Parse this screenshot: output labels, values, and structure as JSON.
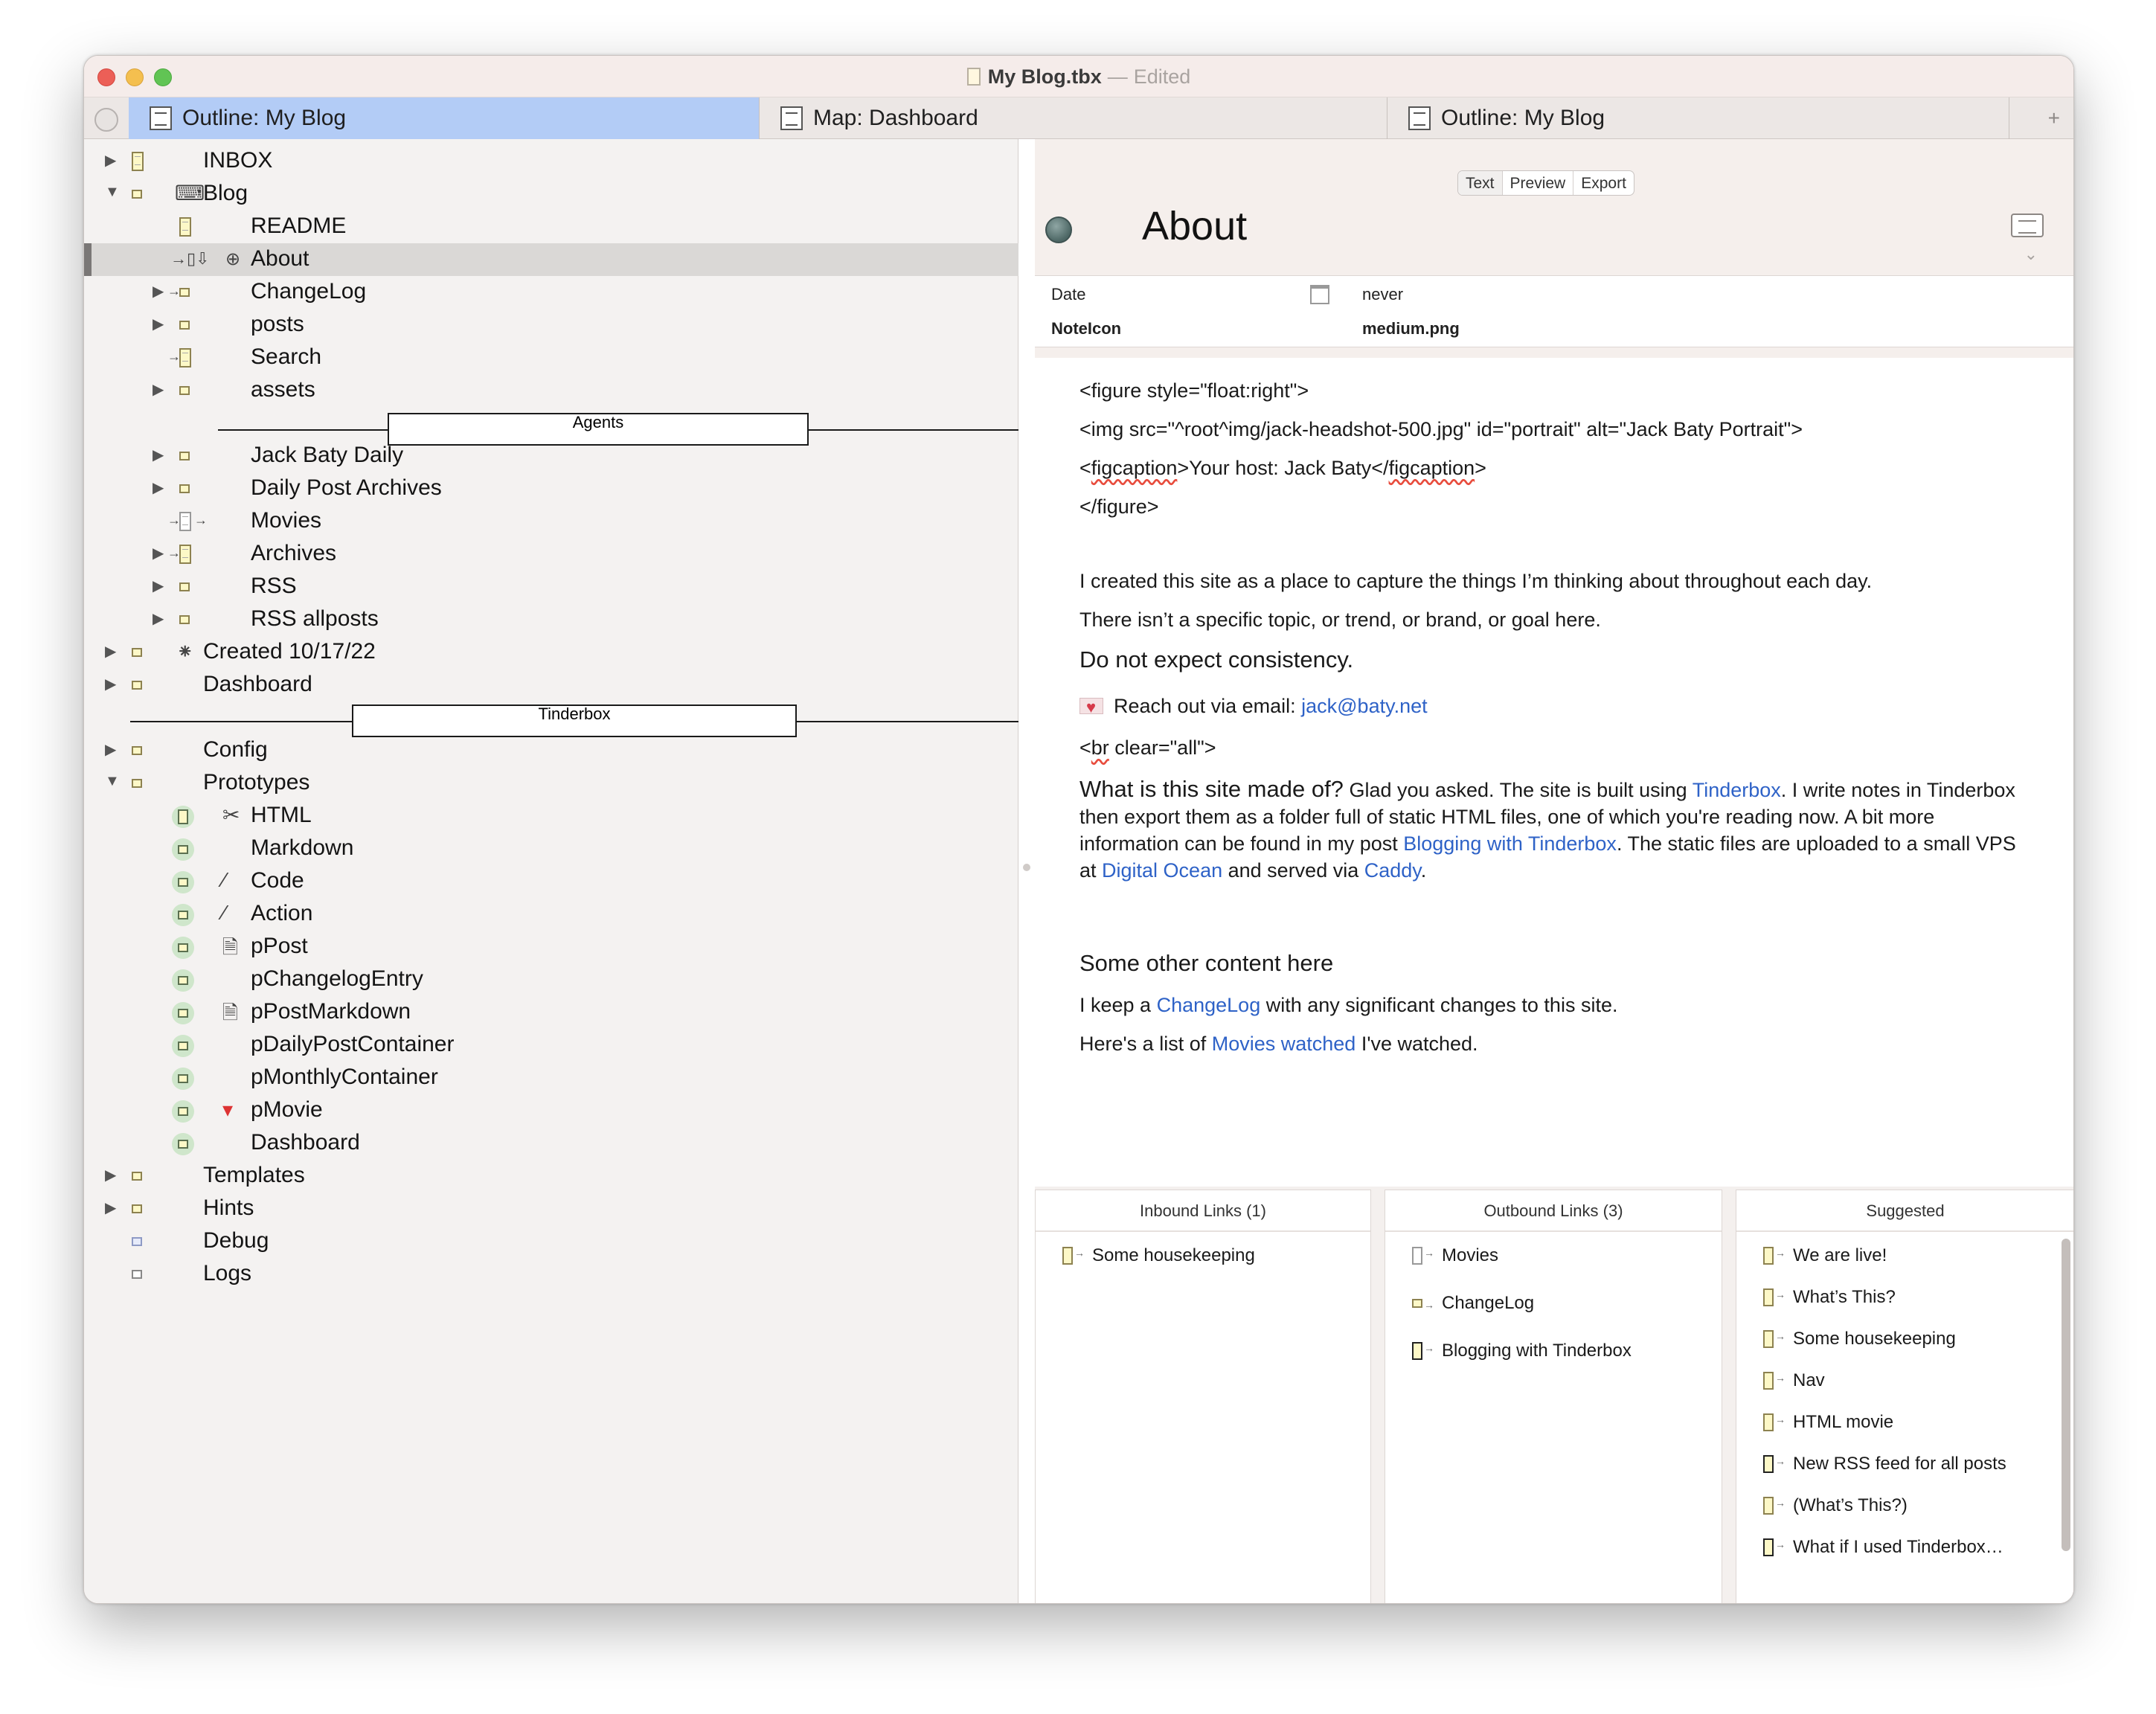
{
  "window": {
    "title": "My Blog.tbx",
    "title_sep": "—",
    "status": "Edited"
  },
  "tabs": [
    {
      "label": "Outline: My Blog",
      "active": true
    },
    {
      "label": "Map: Dashboard",
      "active": false
    },
    {
      "label": "Outline: My Blog",
      "active": false
    }
  ],
  "tab_add": "+",
  "outline": {
    "items": [
      {
        "label": "INBOX"
      },
      {
        "label": "Blog"
      },
      {
        "label": "README"
      },
      {
        "label": "About"
      },
      {
        "label": "ChangeLog"
      },
      {
        "label": "posts"
      },
      {
        "label": "Search"
      },
      {
        "label": "assets"
      },
      {
        "label": "Jack Baty Daily"
      },
      {
        "label": "Daily Post Archives"
      },
      {
        "label": "Movies"
      },
      {
        "label": "Archives"
      },
      {
        "label": "RSS"
      },
      {
        "label": "RSS allposts"
      },
      {
        "label": "Created 10/17/22"
      },
      {
        "label": "Dashboard"
      },
      {
        "label": "Config"
      },
      {
        "label": "Prototypes"
      },
      {
        "label": "HTML"
      },
      {
        "label": "Markdown"
      },
      {
        "label": "Code"
      },
      {
        "label": "Action"
      },
      {
        "label": "pPost"
      },
      {
        "label": "pChangelogEntry"
      },
      {
        "label": "pPostMarkdown"
      },
      {
        "label": "pDailyPostContainer"
      },
      {
        "label": "pMonthlyContainer"
      },
      {
        "label": "pMovie"
      },
      {
        "label": "Dashboard"
      },
      {
        "label": "Templates"
      },
      {
        "label": "Hints"
      },
      {
        "label": "Debug"
      },
      {
        "label": "Logs"
      }
    ],
    "separators": [
      "Agents",
      "Tinderbox"
    ]
  },
  "text_view": {
    "modes": [
      "Text",
      "Preview",
      "Export"
    ],
    "note_title": "About",
    "attributes": [
      {
        "key": "Date",
        "value": "never"
      },
      {
        "key": "NoteIcon",
        "value": "medium.png"
      }
    ],
    "body": {
      "l1": "<figure  style=\"float:right\">",
      "l2": "<img src=\"^root^img/jack-headshot-500.jpg\" id=\"portrait\" alt=\"Jack Baty Portrait\">",
      "l3a": "<",
      "l3b": "figcaption",
      "l3c": ">Your host: Jack Baty</",
      "l3d": "figcaption",
      "l3e": ">",
      "l4": "</figure>",
      "p1": "I created this site as a place to capture the things I’m thinking about throughout each day.",
      "p2": "There isn’t a specific topic, or trend, or brand, or goal here.",
      "p3": "Do not expect consistency.",
      "p4a": "Reach out via email: ",
      "p4link": "jack@baty.net",
      "p5a": "<",
      "p5b": "br",
      "p5c": " clear=\"all\">",
      "p6q": "What is this site made of?",
      "p6a": " Glad you asked. The site is built using ",
      "p6l1": "Tinderbox",
      "p6b": ". I write notes in Tinderbox then export them as a folder full of static HTML files, one of which you're reading now. A bit more information can be found in my post ",
      "p6l2": "Blogging with Tinderbox",
      "p6c": ".  The static files are uploaded to a small VPS at ",
      "p6l3": "Digital Ocean",
      "p6d": " and served via ",
      "p6l4": "Caddy",
      "p6e": ".",
      "h2": "Some other content here",
      "p7a": "I keep a ",
      "p7l": "ChangeLog",
      "p7b": " with any significant changes to this site.",
      "p8a": "Here's a list of ",
      "p8l": "Movies watched",
      "p8b": " I've watched."
    }
  },
  "links": {
    "inbound": {
      "title": "Inbound Links (1)",
      "items": [
        "Some housekeeping"
      ]
    },
    "outbound": {
      "title": "Outbound Links (3)",
      "items": [
        "Movies",
        "ChangeLog",
        "Blogging with Tinderbox"
      ]
    },
    "suggested": {
      "title": "Suggested",
      "items": [
        "We are live!",
        "What’s This?",
        "Some housekeeping",
        "Nav",
        "HTML movie",
        "New RSS feed for all posts",
        "(What’s This?)",
        "What if I used Tinderbox…"
      ]
    }
  }
}
